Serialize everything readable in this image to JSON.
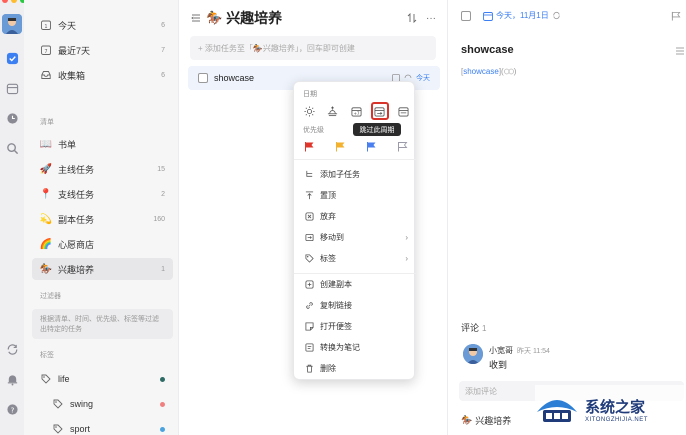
{
  "sidebar": {
    "smart_lists": [
      {
        "icon": "calendar-today-icon",
        "label": "今天",
        "count": "6"
      },
      {
        "icon": "calendar-week-icon",
        "label": "最近7天",
        "count": "7"
      },
      {
        "icon": "inbox-icon",
        "label": "收集箱",
        "count": "6"
      }
    ],
    "lists_header": "清单",
    "lists": [
      {
        "icon": "📖",
        "label": "书单",
        "count": ""
      },
      {
        "icon": "🚀",
        "label": "主线任务",
        "count": "15"
      },
      {
        "icon": "📍",
        "label": "支线任务",
        "count": "2"
      },
      {
        "icon": "💫",
        "label": "副本任务",
        "count": "160"
      },
      {
        "icon": "🌈",
        "label": "心愿商店",
        "count": ""
      },
      {
        "icon": "🏇",
        "label": "兴趣培养",
        "count": "1"
      }
    ],
    "filters_header": "过滤器",
    "filters_hint": "根据清单、时间、优先级、标签等过滤出特定的任务",
    "tags_header": "标签",
    "tags": [
      {
        "label": "life",
        "color": "#2e6b64"
      },
      {
        "label": "swing",
        "color": "#f08080"
      },
      {
        "label": "sport",
        "color": "#4aa3df"
      }
    ]
  },
  "main": {
    "title_icon": "🏇",
    "title": "兴趣培养",
    "add_placeholder": "+ 添加任务至「🏇兴趣培养」，回车即可创建",
    "task": {
      "title": "showcase",
      "due": "今天"
    }
  },
  "menu": {
    "date_label": "日期",
    "date_buttons": [
      "today-sun-icon",
      "tomorrow-sunrise-icon",
      "next-week-calendar-icon",
      "skip-cycle-icon",
      "custom-date-icon"
    ],
    "tooltip": "跳过此周期",
    "priority_label": "优先级",
    "priorities": [
      {
        "name": "high",
        "color": "#e0352b"
      },
      {
        "name": "medium",
        "color": "#f2b230"
      },
      {
        "name": "low",
        "color": "#4a7ff0"
      },
      {
        "name": "none",
        "color": "#9a9aa8"
      }
    ],
    "items_a": [
      {
        "icon": "subtask-icon",
        "label": "添加子任务",
        "arrow": ""
      },
      {
        "icon": "pin-icon",
        "label": "置顶",
        "arrow": ""
      },
      {
        "icon": "abandon-icon",
        "label": "放弃",
        "arrow": ""
      },
      {
        "icon": "move-icon",
        "label": "移动到",
        "arrow": "›"
      },
      {
        "icon": "tag-icon",
        "label": "标签",
        "arrow": "›"
      }
    ],
    "items_b": [
      {
        "icon": "copy-icon",
        "label": "创建副本"
      },
      {
        "icon": "link-icon",
        "label": "复制链接"
      },
      {
        "icon": "sticky-note-icon",
        "label": "打开便签"
      },
      {
        "icon": "convert-note-icon",
        "label": "转换为笔记"
      },
      {
        "icon": "trash-icon",
        "label": "删除"
      }
    ]
  },
  "detail": {
    "date": "今天，11月1日",
    "title": "showcase",
    "link_text": "showcase",
    "comments_label": "评论",
    "comments_count": "1",
    "comment": {
      "user": "小宽哥",
      "time": "昨天 11:54",
      "text": "收到"
    },
    "comment_placeholder": "添加评论",
    "footer_list_icon": "🏇",
    "footer_list": "兴趣培养"
  },
  "watermark": {
    "name": "系统之家",
    "url": "XITONGZHIJIA.NET"
  }
}
